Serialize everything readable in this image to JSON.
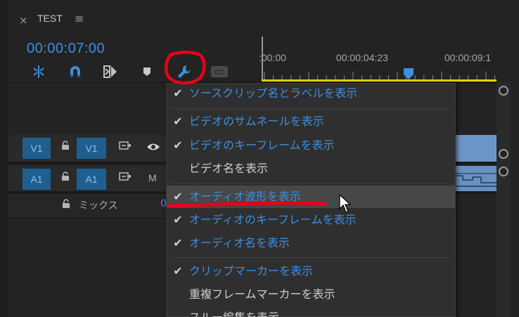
{
  "tab": {
    "close": "×",
    "title": "TEST",
    "menu": "≡"
  },
  "timecode": "00:00:07:00",
  "toolbar": {
    "tools": [
      {
        "name": "snap-in-sequence-icon"
      },
      {
        "name": "magnet-snap-icon"
      },
      {
        "name": "linked-selection-icon"
      },
      {
        "name": "add-marker-icon"
      },
      {
        "name": "wrench-settings-icon"
      },
      {
        "name": "captions-icon",
        "label": "CC"
      }
    ]
  },
  "ruler": {
    "labels": [
      ":00:00",
      "00:00:04:23",
      "00:00:09:1"
    ]
  },
  "tracks": [
    {
      "source": "V1",
      "target": "V1",
      "toggle": "eye-icon"
    },
    {
      "source": "A1",
      "target": "A1",
      "toggle": "M"
    }
  ],
  "mix": {
    "label": "ミックス",
    "value": "0"
  },
  "menu": {
    "items": [
      {
        "label": "ソースクリップ名とラベルを表示",
        "checked": true
      },
      {
        "label": "ビデオのサムネールを表示",
        "checked": true
      },
      {
        "label": "ビデオのキーフレームを表示",
        "checked": true
      },
      {
        "label": "ビデオ名を表示",
        "checked": false
      },
      {
        "label": "オーディオ波形を表示",
        "checked": true,
        "highlighted": true
      },
      {
        "label": "オーディオのキーフレームを表示",
        "checked": true
      },
      {
        "label": "オーディオ名を表示",
        "checked": true
      },
      {
        "label": "クリップマーカーを表示",
        "checked": true
      },
      {
        "label": "重複フレームマーカーを表示",
        "checked": false
      },
      {
        "label": "スルー編集を表示",
        "checked": false
      }
    ]
  },
  "colors": {
    "accent_blue": "#3d8fe0",
    "annotation_red": "#e8001a",
    "ruler_yellow": "#e4d400",
    "track_button_blue": "#1f5f8f"
  }
}
